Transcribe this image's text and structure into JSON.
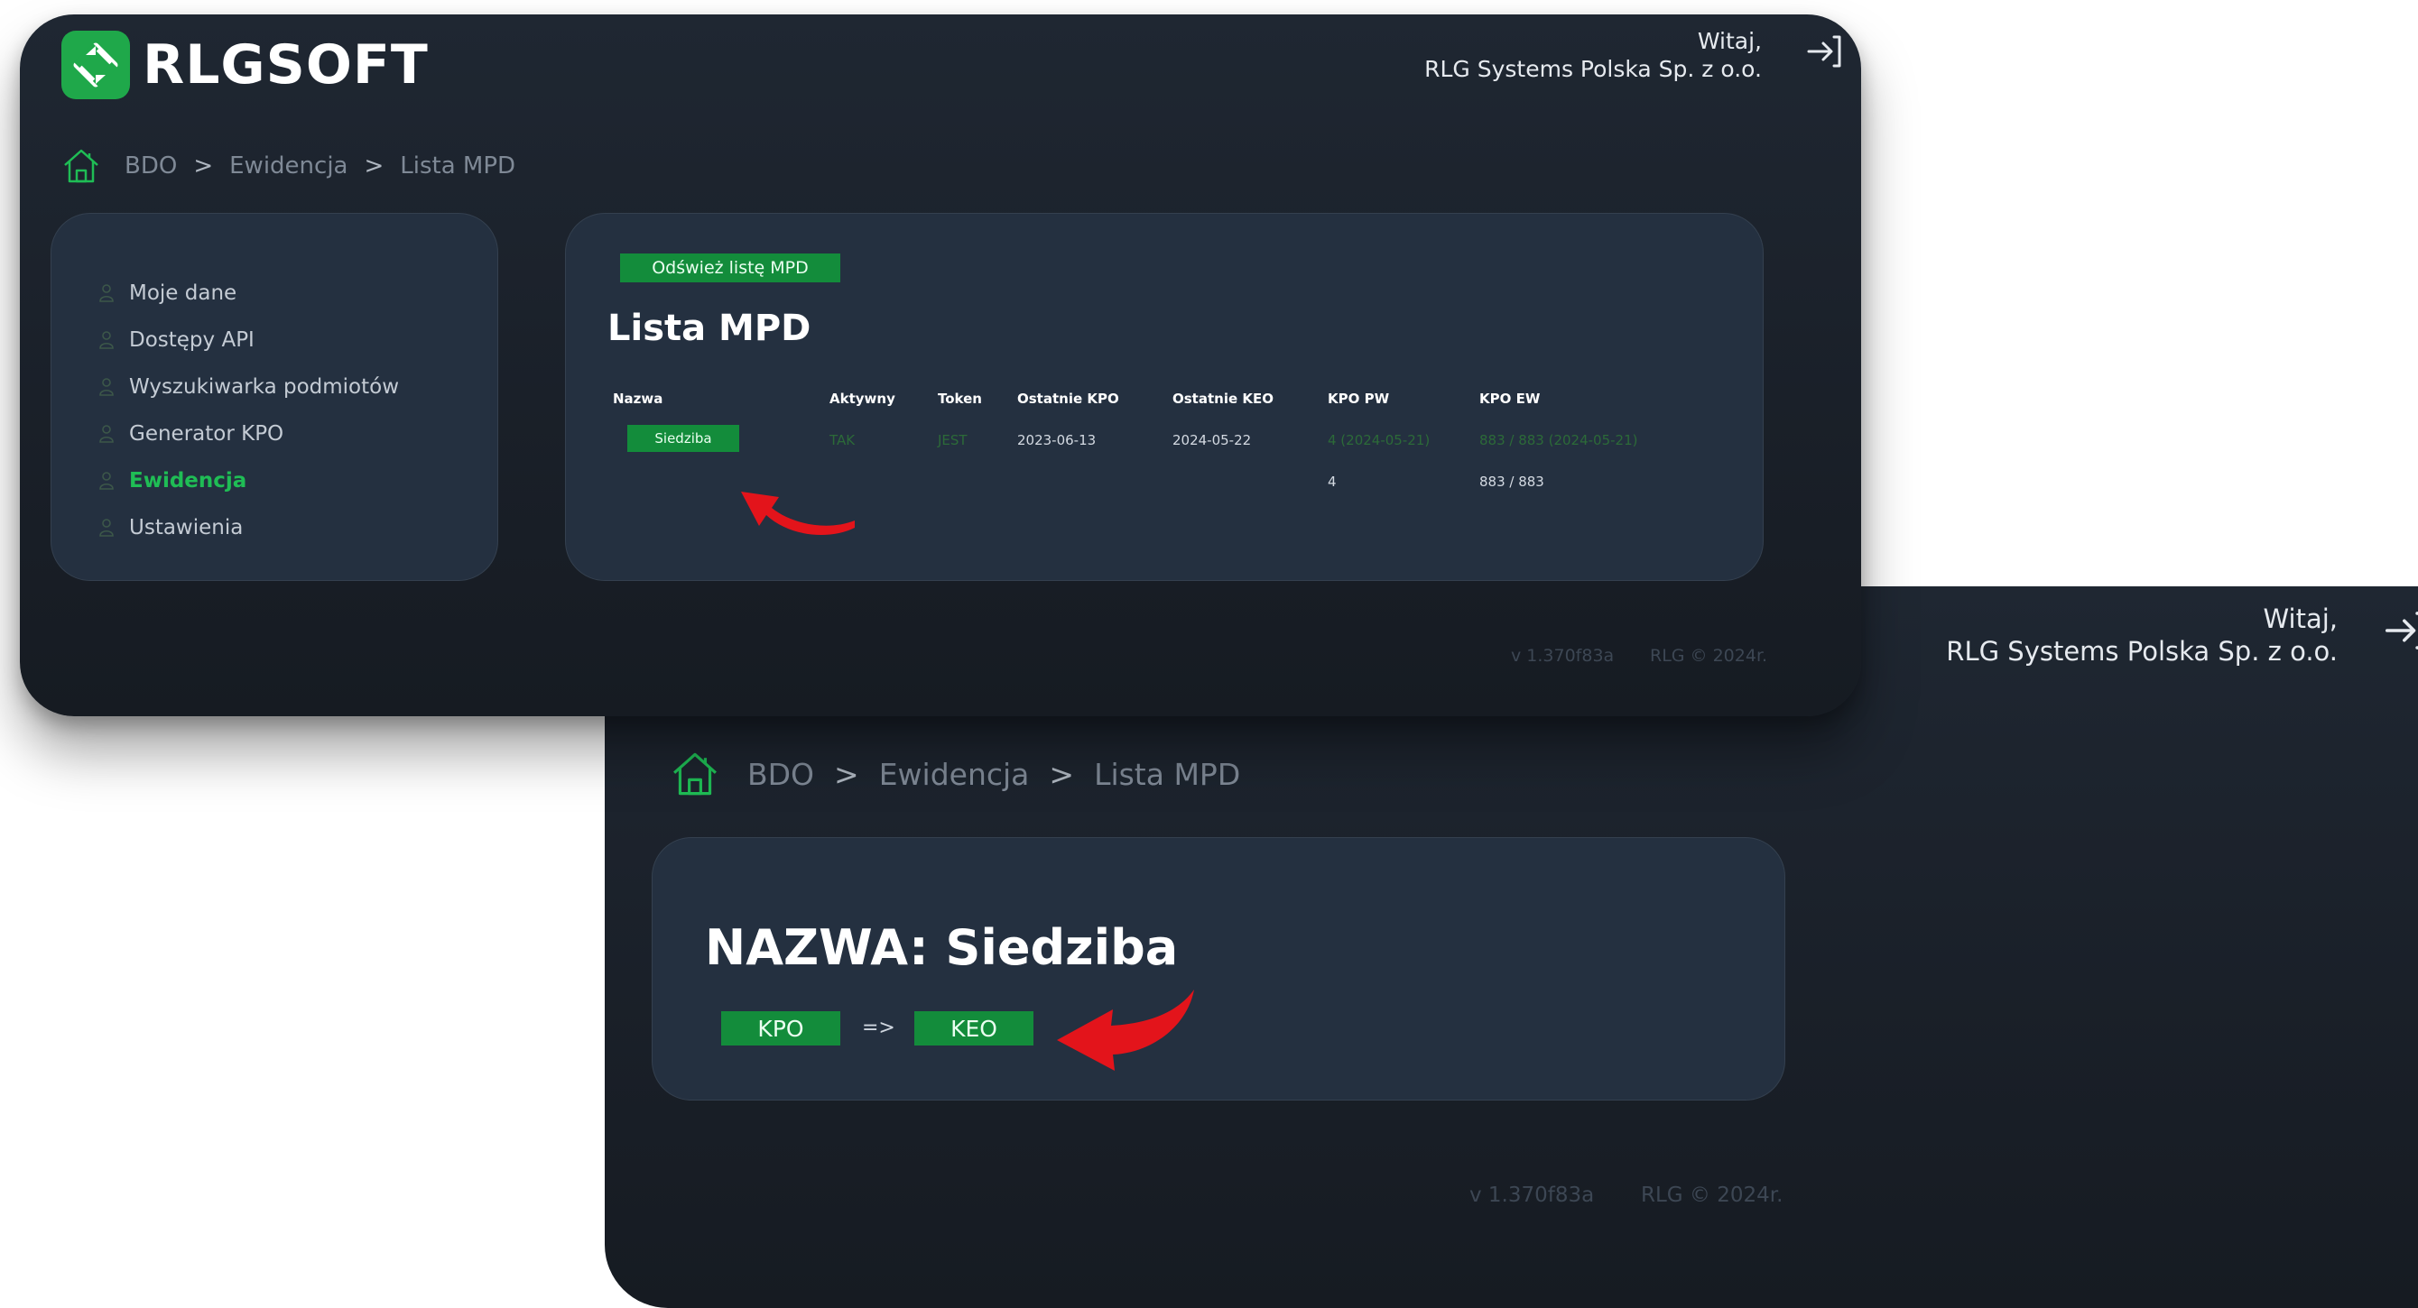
{
  "brand": {
    "name": "RLGSOFT",
    "color": "#1fa84a"
  },
  "header": {
    "greeting": "Witaj,",
    "company": "RLG Systems Polska Sp. z o.o.",
    "logout_icon": "logout-icon"
  },
  "breadcrumb": {
    "items": [
      "BDO",
      "Ewidencja",
      "Lista MPD"
    ],
    "separator": ">"
  },
  "sidebar": {
    "items": [
      {
        "label": "Moje dane",
        "active": false
      },
      {
        "label": "Dostępy API",
        "active": false
      },
      {
        "label": "Wyszukiwarka podmiotów",
        "active": false
      },
      {
        "label": "Generator KPO",
        "active": false
      },
      {
        "label": "Ewidencja",
        "active": true
      },
      {
        "label": "Ustawienia",
        "active": false
      }
    ]
  },
  "main": {
    "refresh_button": "Odśwież listę MPD",
    "title": "Lista MPD",
    "table": {
      "columns": [
        "Nazwa",
        "Aktywny",
        "Token",
        "Ostatnie KPO",
        "Ostatnie KEO",
        "KPO PW",
        "KPO EW"
      ],
      "row": {
        "nazwa": "Siedziba",
        "aktywny": "TAK",
        "token": "JEST",
        "ostatnie_kpo": "2023-06-13",
        "ostatnie_keo": "2024-05-22",
        "kpo_pw": "4 (2024-05-21)",
        "kpo_ew": "883 / 883 (2024-05-21)"
      },
      "summary": {
        "kpo_pw": "4",
        "kpo_ew": "883 / 883"
      }
    }
  },
  "footer": {
    "version": "v 1.370f83a",
    "copyright": "RLG © 2024r."
  },
  "detail": {
    "title": "NAZWA: Siedziba",
    "kpo_button": "KPO",
    "arrow": "=>",
    "keo_button": "KEO"
  },
  "colors": {
    "accent": "#1fbd55",
    "button": "#138c3b",
    "annotation_arrow": "#e3141b"
  }
}
